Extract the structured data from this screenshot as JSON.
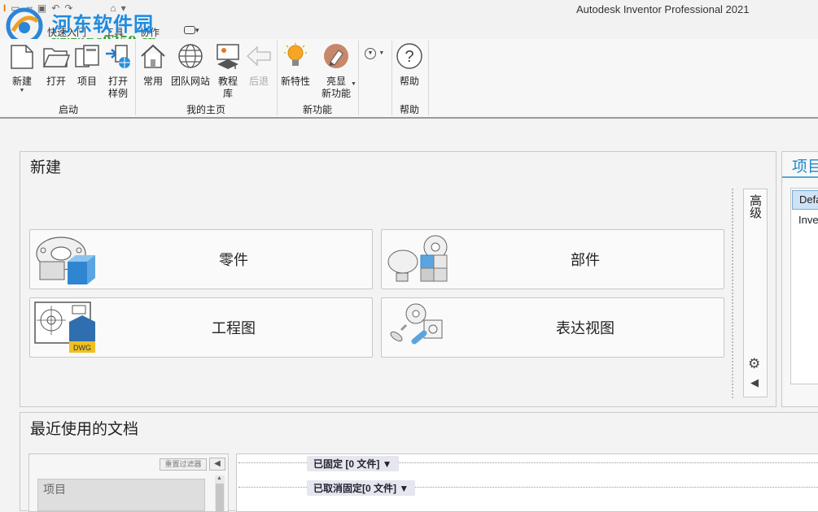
{
  "app": {
    "title": "Autodesk Inventor Professional 2021"
  },
  "watermark": {
    "name": "河东软件园",
    "url": "www.pc0359.cn"
  },
  "tabs": [
    {
      "label": "快速入门"
    },
    {
      "label": "工具"
    },
    {
      "label": "协作"
    },
    {
      "label": "▾"
    }
  ],
  "ribbon": {
    "groups": {
      "launch": "启动",
      "home": "我的主页",
      "new_features": "新功能",
      "help": "帮助"
    },
    "buttons": {
      "new": "新建",
      "open": "打开",
      "project": "项目",
      "open_samples": "打开\n样例",
      "common": "常用",
      "team_site": "团队网站",
      "tutorials": "教程\n库",
      "back": "后退",
      "whats_new": "新特性",
      "highlight": "亮显\n新功能",
      "help": "帮助"
    }
  },
  "new_panel": {
    "title": "新建",
    "tiles": [
      "零件",
      "部件",
      "工程图",
      "表达视图"
    ],
    "advanced": "高级",
    "dwg_badge": "DWG"
  },
  "projects_panel": {
    "title": "项目",
    "items": [
      "Default",
      "Inventor"
    ]
  },
  "recent_panel": {
    "title": "最近使用的文档",
    "reset_filter": "重置过滤器",
    "collapse": "◀",
    "filter_header": "项目",
    "pinned": "已固定 [0 文件] ▼",
    "unpinned": "已取消固定[0 文件] ▼"
  }
}
